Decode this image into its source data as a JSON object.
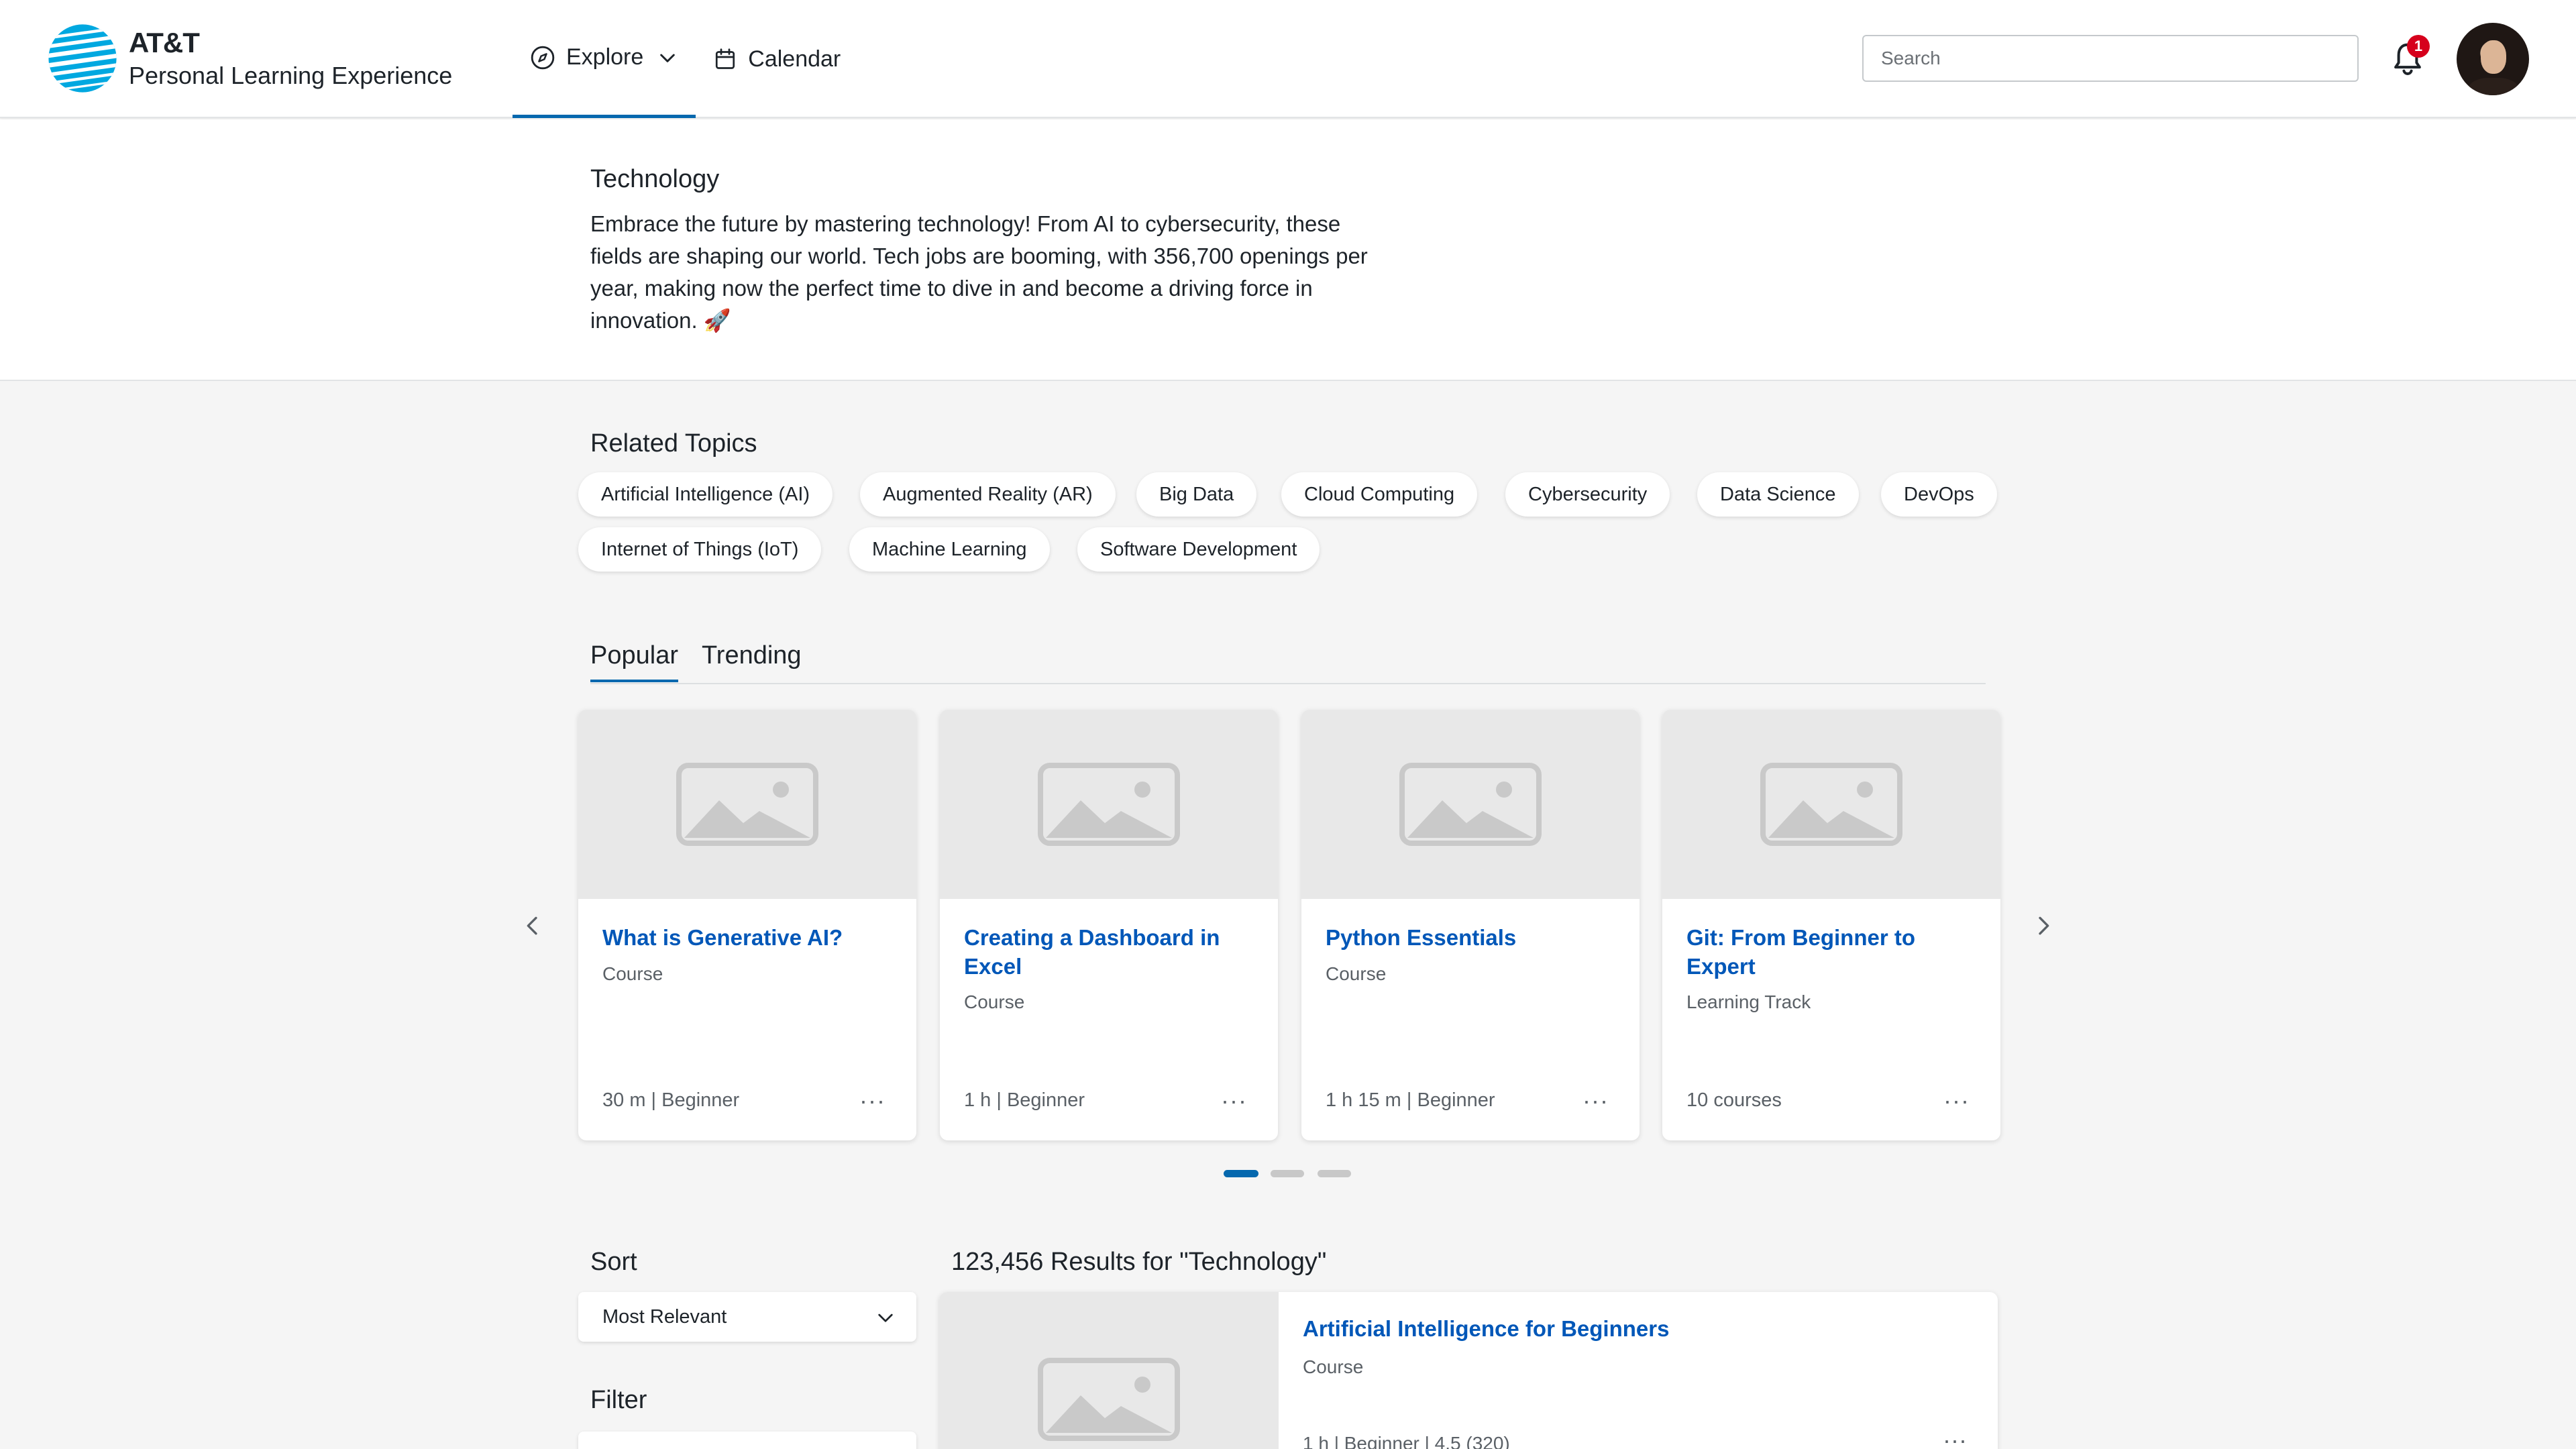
{
  "header": {
    "brand_name": "AT&T",
    "brand_subtitle": "Personal Learning Experience",
    "nav": [
      {
        "label": "Explore",
        "icon": "compass-icon",
        "active": true
      },
      {
        "label": "Calendar",
        "icon": "calendar-icon",
        "active": false
      }
    ],
    "search_placeholder": "Search",
    "notification_count": "1",
    "colors": {
      "accent": "#0568ae",
      "link": "#0057b8",
      "badge": "#d6001c",
      "brand_blue": "#00a8e0"
    }
  },
  "topic": {
    "title": "Technology",
    "description": "Embrace the future by mastering technology! From AI to cybersecurity, these fields are shaping our world. Tech jobs are booming, with 356,700 openings per year, making now the perfect time to dive in and become a driving force in innovation. 🚀"
  },
  "related": {
    "title": "Related Topics",
    "chips": [
      "Artificial Intelligence (AI)",
      "Augmented Reality (AR)",
      "Big Data",
      "Cloud Computing",
      "Cybersecurity",
      "Data Science",
      "DevOps",
      "Internet of Things (IoT)",
      "Machine Learning",
      "Software Development"
    ]
  },
  "tabs": [
    {
      "label": "Popular",
      "active": true
    },
    {
      "label": "Trending",
      "active": false
    }
  ],
  "cards": [
    {
      "title": "What is Generative AI?",
      "type": "Course",
      "meta": "30 m | Beginner",
      "more": "···"
    },
    {
      "title": "Creating a Dashboard in Excel",
      "type": "Course",
      "meta": "1 h | Beginner",
      "more": "···"
    },
    {
      "title": "Python Essentials",
      "type": "Course",
      "meta": "1 h 15 m | Beginner",
      "more": "···"
    },
    {
      "title": "Git: From Beginner to Expert",
      "type": "Learning Track",
      "meta": "10 courses",
      "more": "···"
    }
  ],
  "carousel": {
    "pages": 3,
    "active_page": 1
  },
  "sort": {
    "label": "Sort",
    "selected": "Most Relevant"
  },
  "filter": {
    "label": "Filter"
  },
  "results": {
    "count_text": "123,456 Results for \"Technology\"",
    "items": [
      {
        "title": "Artificial Intelligence for Beginners",
        "type": "Course",
        "meta": "1 h | Beginner | 4.5 (320)",
        "more": "···"
      }
    ]
  }
}
